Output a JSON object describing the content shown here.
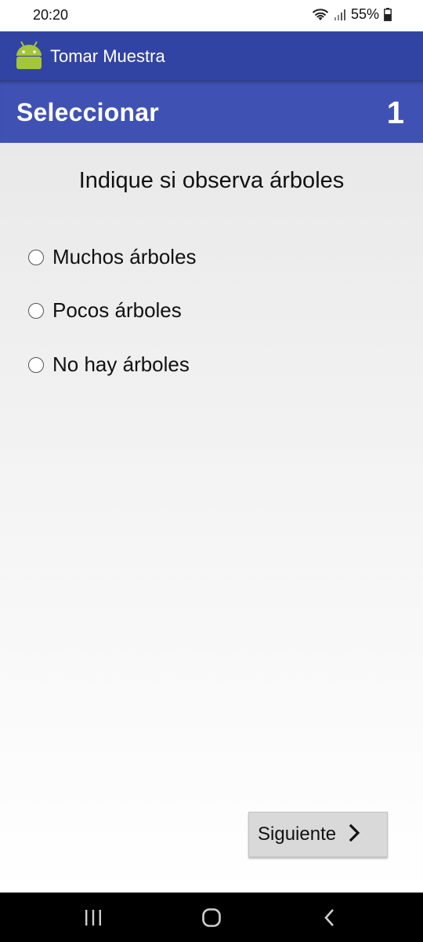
{
  "status_bar": {
    "time": "20:20",
    "battery": "55%"
  },
  "app_bar": {
    "title": "Tomar Muestra"
  },
  "header": {
    "title": "Seleccionar",
    "number": "1"
  },
  "question": {
    "text": "Indique si observa árboles",
    "options": [
      {
        "label": "Muchos árboles",
        "selected": false
      },
      {
        "label": "Pocos árboles",
        "selected": false
      },
      {
        "label": "No hay árboles",
        "selected": false
      }
    ]
  },
  "footer": {
    "next_label": "Siguiente"
  },
  "colors": {
    "app_bar": "#3244a3",
    "header_band": "#3f52b4",
    "android_green": "#a4c639"
  },
  "icons": {
    "app": "android-icon",
    "next": "chevron-right-icon",
    "nav_recents": "recents-icon",
    "nav_home": "home-icon",
    "nav_back": "back-icon"
  }
}
